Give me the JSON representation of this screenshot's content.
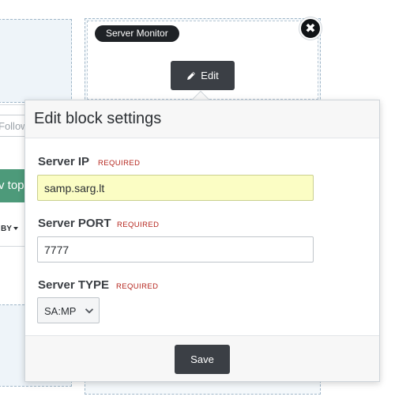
{
  "background": {
    "follow_placeholder": "Follow",
    "topic_button_label": "v topic",
    "sort_label": "BY"
  },
  "block": {
    "tag": "Server Monitor",
    "close_icon": "close-icon",
    "edit_label": "Edit",
    "edit_icon": "pencil-icon"
  },
  "popover": {
    "title": "Edit block settings",
    "required_text": "REQUIRED",
    "fields": [
      {
        "label": "Server IP",
        "value": "samp.sarg.lt"
      },
      {
        "label": "Server PORT",
        "value": "7777"
      },
      {
        "label": "Server TYPE",
        "value": "SA:MP"
      }
    ],
    "save_label": "Save"
  },
  "colors": {
    "dark_button": "#3b3f45",
    "highlight_input": "#fbfdc4",
    "required": "#b5261e",
    "topic_green": "#4d9a7a"
  }
}
